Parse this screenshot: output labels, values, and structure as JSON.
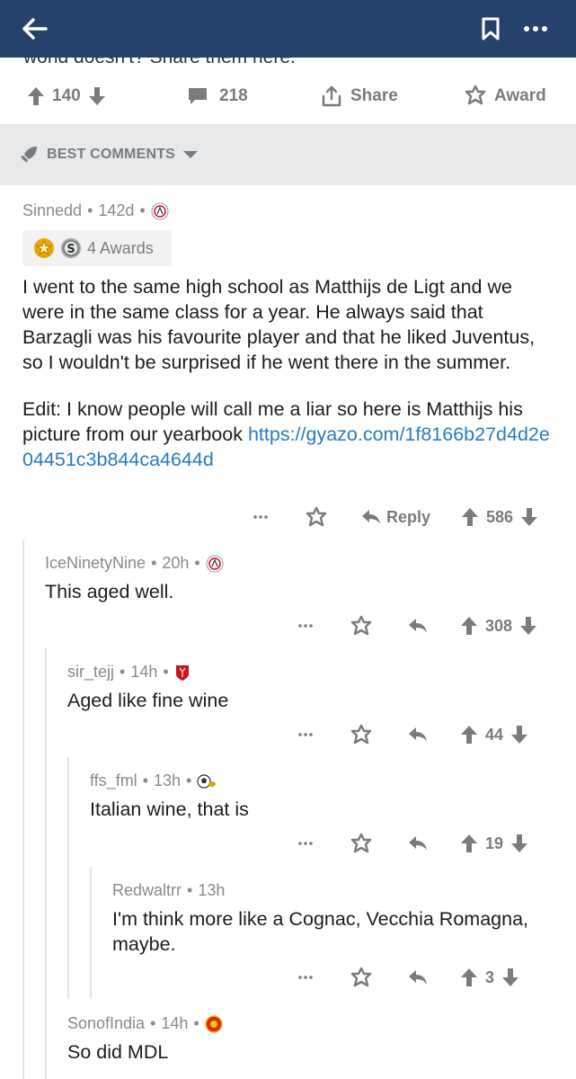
{
  "appbar": {
    "back_icon": "arrow-left-icon",
    "save_icon": "bookmark-icon",
    "more_icon": "more-horizontal-icon"
  },
  "post": {
    "cut_title": "world doesn't? Share them here.",
    "upvotes": "140",
    "comments": "218",
    "share_label": "Share",
    "award_label": "Award"
  },
  "sort": {
    "label": "BEST COMMENTS"
  },
  "comments": [
    {
      "author": "Sinnedd",
      "age": "142d",
      "awards_label": "4 Awards",
      "body_p1": "I went to the same high school as Matthijs de Ligt and we were in the same class for a year. He always said that Barzagli was his favourite player and that he liked Juventus, so I wouldn't be surprised if he went there in the summer.",
      "body_p2": "Edit: I know people will call me a liar so here is Matthijs his picture from our yearbook ",
      "link": "https://gyazo.com/1f8166b27d4d2e04451c3b844ca4644d",
      "reply_label": "Reply",
      "score": "586"
    },
    {
      "author": "IceNinetyNine",
      "age": "20h",
      "body": "This aged well.",
      "score": "308"
    },
    {
      "author": "sir_tejj",
      "age": "14h",
      "body": "Aged like fine wine",
      "score": "44"
    },
    {
      "author": "ffs_fml",
      "age": "13h",
      "body": "Italian wine, that is",
      "score": "19"
    },
    {
      "author": "Redwaltrr",
      "age": "13h",
      "body": "I'm think more like a Cognac, Vecchia Romagna, maybe.",
      "score": "3"
    },
    {
      "author": "SonofIndia",
      "age": "14h",
      "body": "So did MDL"
    }
  ],
  "colors": {
    "appbar": "#24426b",
    "link": "#2a7bbf",
    "meta": "#878a8c",
    "sortbar": "#e8e9ea"
  }
}
